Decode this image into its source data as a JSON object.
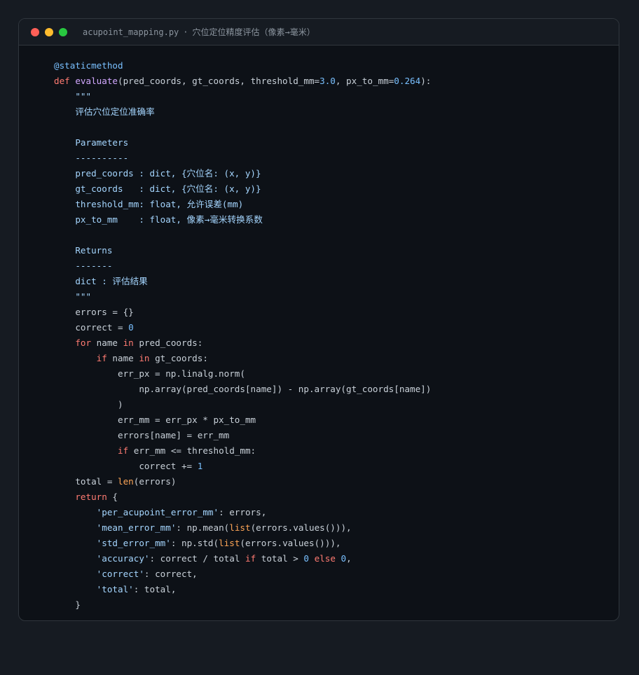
{
  "window": {
    "filename": "acupoint_mapping.py",
    "separator": "·",
    "subtitle": "穴位定位精度评估（像素→毫米）",
    "traffic_lights": [
      "close",
      "minimize",
      "maximize"
    ]
  },
  "colors": {
    "background": "#161b22",
    "editor_bg": "#0d1117",
    "keyword": "#ff7b72",
    "function": "#d2a8ff",
    "number": "#79c0ff",
    "string": "#a5d6ff",
    "builtin": "#ffa657",
    "text": "#c9d1d9"
  },
  "code_lines": [
    [
      {
        "t": "@staticmethod",
        "c": "dec"
      }
    ],
    [
      {
        "t": "def",
        "c": "kw"
      },
      {
        "t": " "
      },
      {
        "t": "evaluate",
        "c": "fn"
      },
      {
        "t": "(pred_coords, gt_coords, threshold_mm="
      },
      {
        "t": "3.0",
        "c": "num"
      },
      {
        "t": ", px_to_mm="
      },
      {
        "t": "0.264",
        "c": "num"
      },
      {
        "t": "):"
      }
    ],
    [
      {
        "t": "    \"\"\"",
        "c": "str"
      }
    ],
    [
      {
        "t": "    评估穴位定位准确率",
        "c": "str"
      }
    ],
    [
      {
        "t": ""
      }
    ],
    [
      {
        "t": "    Parameters",
        "c": "str"
      }
    ],
    [
      {
        "t": "    ----------",
        "c": "str"
      }
    ],
    [
      {
        "t": "    pred_coords : dict, {穴位名: (x, y)}",
        "c": "str"
      }
    ],
    [
      {
        "t": "    gt_coords   : dict, {穴位名: (x, y)}",
        "c": "str"
      }
    ],
    [
      {
        "t": "    threshold_mm: float, 允许误差(mm)",
        "c": "str"
      }
    ],
    [
      {
        "t": "    px_to_mm    : float, 像素→毫米转换系数",
        "c": "str"
      }
    ],
    [
      {
        "t": ""
      }
    ],
    [
      {
        "t": "    Returns",
        "c": "str"
      }
    ],
    [
      {
        "t": "    -------",
        "c": "str"
      }
    ],
    [
      {
        "t": "    dict : 评估结果",
        "c": "str"
      }
    ],
    [
      {
        "t": "    \"\"\"",
        "c": "str"
      }
    ],
    [
      {
        "t": "    errors = {}"
      }
    ],
    [
      {
        "t": "    correct = "
      },
      {
        "t": "0",
        "c": "num"
      }
    ],
    [
      {
        "t": "    "
      },
      {
        "t": "for",
        "c": "kw"
      },
      {
        "t": " name "
      },
      {
        "t": "in",
        "c": "kw"
      },
      {
        "t": " pred_coords:"
      }
    ],
    [
      {
        "t": "        "
      },
      {
        "t": "if",
        "c": "kw"
      },
      {
        "t": " name "
      },
      {
        "t": "in",
        "c": "kw"
      },
      {
        "t": " gt_coords:"
      }
    ],
    [
      {
        "t": "            err_px = np.linalg.norm("
      }
    ],
    [
      {
        "t": "                np.array(pred_coords[name]) - np.array(gt_coords[name])"
      }
    ],
    [
      {
        "t": "            )"
      }
    ],
    [
      {
        "t": "            err_mm = err_px * px_to_mm"
      }
    ],
    [
      {
        "t": "            errors[name] = err_mm"
      }
    ],
    [
      {
        "t": "            "
      },
      {
        "t": "if",
        "c": "kw"
      },
      {
        "t": " err_mm <= threshold_mm:"
      }
    ],
    [
      {
        "t": "                correct += "
      },
      {
        "t": "1",
        "c": "num"
      }
    ],
    [
      {
        "t": "    total = "
      },
      {
        "t": "len",
        "c": "bi"
      },
      {
        "t": "(errors)"
      }
    ],
    [
      {
        "t": "    "
      },
      {
        "t": "return",
        "c": "kw"
      },
      {
        "t": " {"
      }
    ],
    [
      {
        "t": "        "
      },
      {
        "t": "'per_acupoint_error_mm'",
        "c": "str"
      },
      {
        "t": ": errors,"
      }
    ],
    [
      {
        "t": "        "
      },
      {
        "t": "'mean_error_mm'",
        "c": "str"
      },
      {
        "t": ": np.mean("
      },
      {
        "t": "list",
        "c": "bi"
      },
      {
        "t": "(errors.values())),"
      }
    ],
    [
      {
        "t": "        "
      },
      {
        "t": "'std_error_mm'",
        "c": "str"
      },
      {
        "t": ": np.std("
      },
      {
        "t": "list",
        "c": "bi"
      },
      {
        "t": "(errors.values())),"
      }
    ],
    [
      {
        "t": "        "
      },
      {
        "t": "'accuracy'",
        "c": "str"
      },
      {
        "t": ": correct / total "
      },
      {
        "t": "if",
        "c": "kw"
      },
      {
        "t": " total > "
      },
      {
        "t": "0",
        "c": "num"
      },
      {
        "t": " "
      },
      {
        "t": "else",
        "c": "kw"
      },
      {
        "t": " "
      },
      {
        "t": "0",
        "c": "num"
      },
      {
        "t": ","
      }
    ],
    [
      {
        "t": "        "
      },
      {
        "t": "'correct'",
        "c": "str"
      },
      {
        "t": ": correct,"
      }
    ],
    [
      {
        "t": "        "
      },
      {
        "t": "'total'",
        "c": "str"
      },
      {
        "t": ": total,"
      }
    ],
    [
      {
        "t": "    }"
      }
    ]
  ]
}
